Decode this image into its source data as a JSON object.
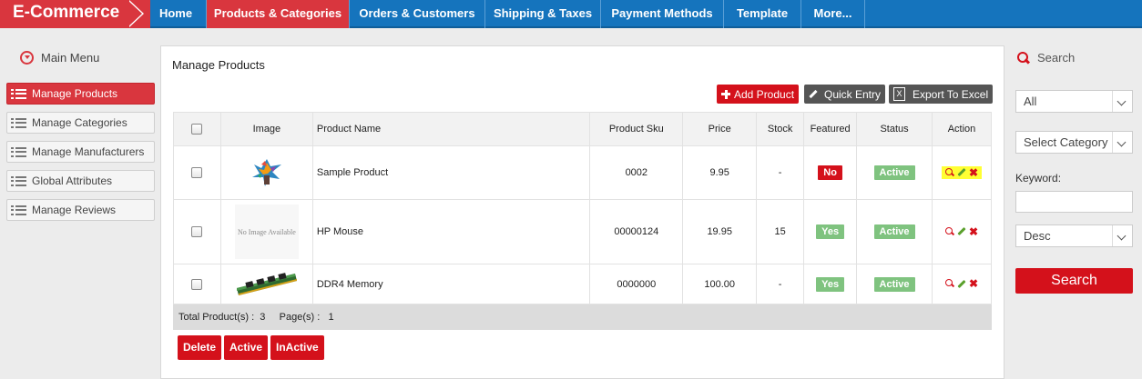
{
  "brand": "E-Commerce",
  "nav": [
    "Home",
    "Products & Categories",
    "Orders & Customers",
    "Shipping & Taxes",
    "Payment Methods",
    "Template",
    "More..."
  ],
  "sidebar": {
    "title": "Main Menu",
    "items": [
      "Manage Products",
      "Manage Categories",
      "Manage Manufacturers",
      "Global Attributes",
      "Manage Reviews"
    ]
  },
  "main": {
    "title": "Manage Products",
    "add_product": "Add Product",
    "quick_entry": "Quick Entry",
    "export_excel": "Export To Excel",
    "excel_glyph": "X",
    "columns": [
      "Image",
      "Product Name",
      "Product Sku",
      "Price",
      "Stock",
      "Featured",
      "Status",
      "Action"
    ],
    "rows": [
      {
        "name": "Sample Product",
        "sku": "0002",
        "price": "9.95",
        "stock": "-",
        "featured": "No",
        "status": "Active"
      },
      {
        "name": "HP Mouse",
        "sku": "00000124",
        "price": "19.95",
        "stock": "15",
        "featured": "Yes",
        "status": "Active"
      },
      {
        "name": "DDR4 Memory",
        "sku": "0000000",
        "price": "100.00",
        "stock": "-",
        "featured": "Yes",
        "status": "Active"
      }
    ],
    "no_image_text": "No Image Available",
    "totals": "Total Product(s) :  3     Page(s) :   1",
    "delete": "Delete",
    "active": "Active",
    "inactive": "InActive"
  },
  "search": {
    "title": "Search",
    "filter_value": "All",
    "category_value": "Select Category",
    "keyword_label": "Keyword:",
    "sort_value": "Desc",
    "button": "Search"
  },
  "colors": {
    "nav_blue": "#1574bd",
    "accent_red": "#d4111b",
    "badge_green": "#7fc37f",
    "highlight_yellow": "#ffff33"
  }
}
